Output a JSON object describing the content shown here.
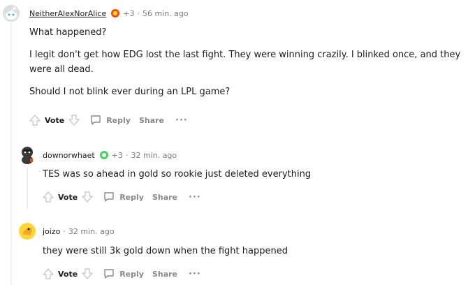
{
  "comments": [
    {
      "author": "NeitherAlexNorAlice",
      "score": "+3",
      "time": "56 min. ago",
      "paragraphs": [
        "What happened?",
        "I legit don't get how EDG lost the last fight. They were winning crazily. I blinked once, and they were all dead.",
        "Should I not blink ever during an LPL game?"
      ],
      "flair_icon": "flame-badge-icon",
      "avatar_icon": "snoo-avatar-icon"
    },
    {
      "author": "downorwhaet",
      "score": "+3",
      "time": "32 min. ago",
      "paragraphs": [
        "TES was so ahead in gold so rookie just deleted everything"
      ],
      "flair_icon": "green-badge-icon",
      "avatar_icon": "character-avatar-icon"
    },
    {
      "author": "joizo",
      "time": "32 min. ago",
      "paragraphs": [
        "they were still 3k gold down when the fight happened"
      ],
      "avatar_icon": "yellow-avatar-icon"
    }
  ],
  "actions": {
    "vote": "Vote",
    "reply": "Reply",
    "share": "Share",
    "more": "···"
  },
  "colors": {
    "text": "#1c1c1c",
    "muted": "#878a8c",
    "thread_line": "#edeff1",
    "flair_orange": "#ff4500",
    "flair_green": "#46d160"
  }
}
